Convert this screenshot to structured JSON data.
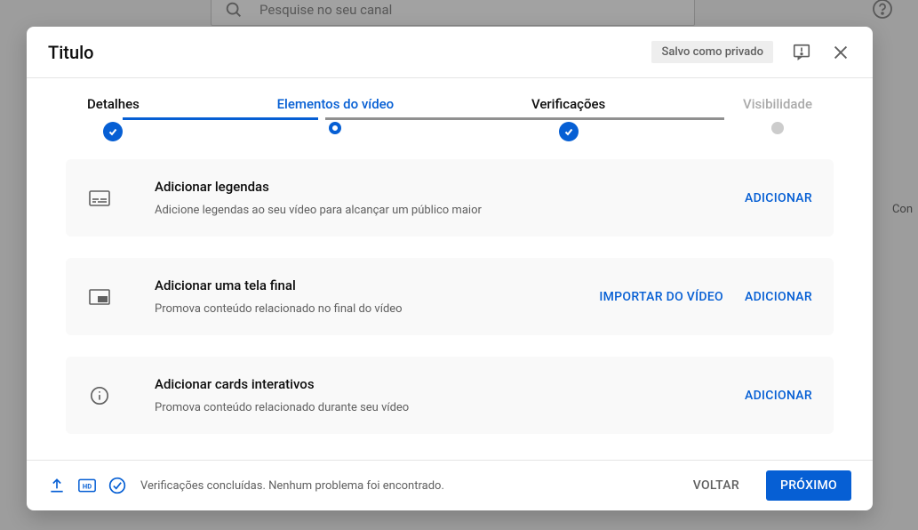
{
  "background": {
    "search_placeholder": "Pesquise no seu canal",
    "right_text": "Con"
  },
  "modal": {
    "title": "Titulo",
    "save_badge": "Salvo como privado"
  },
  "stepper": {
    "steps": [
      {
        "label": "Detalhes",
        "state": "done"
      },
      {
        "label": "Elementos do vídeo",
        "state": "current"
      },
      {
        "label": "Verificações",
        "state": "done"
      },
      {
        "label": "Visibilidade",
        "state": "disabled"
      }
    ]
  },
  "cards": [
    {
      "icon": "subtitles-icon",
      "title": "Adicionar legendas",
      "desc": "Adicione legendas ao seu vídeo para alcançar um público maior",
      "actions": [
        {
          "label": "ADICIONAR"
        }
      ]
    },
    {
      "icon": "endscreen-icon",
      "title": "Adicionar uma tela final",
      "desc": "Promova conteúdo relacionado no final do vídeo",
      "actions": [
        {
          "label": "IMPORTAR DO VÍDEO"
        },
        {
          "label": "ADICIONAR"
        }
      ]
    },
    {
      "icon": "cards-icon",
      "title": "Adicionar cards interativos",
      "desc": "Promova conteúdo relacionado durante seu vídeo",
      "actions": [
        {
          "label": "ADICIONAR"
        }
      ]
    }
  ],
  "footer": {
    "status": "Verificações concluídas. Nenhum problema foi encontrado.",
    "back": "VOLTAR",
    "next": "PRÓXIMO"
  }
}
